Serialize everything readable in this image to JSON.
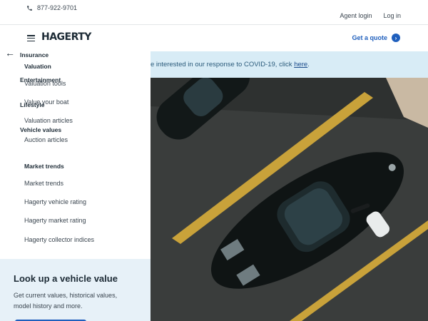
{
  "topbar": {
    "phone": "877-922-9701",
    "agent_login": "Agent login",
    "log_in": "Log in"
  },
  "header": {
    "logo": "HAGERTY",
    "get_quote": "Get a quote"
  },
  "banner": {
    "text": "e interested in our response to COVID-19, click ",
    "link": "here",
    "end": "."
  },
  "menu": {
    "categories": {
      "insurance": "Insurance",
      "entertainment": "Entertainment",
      "lifestyle": "Lifestyle",
      "vehicle_values": "Vehicle values"
    },
    "valuation_title": "Valuation",
    "valuation_items": [
      "Valuation tools",
      "Value your boat",
      "Valuation articles",
      "Auction articles"
    ],
    "trends_title": "Market trends",
    "trends_items": [
      "Market trends",
      "Hagerty vehicle rating",
      "Hagerty market rating",
      "Hagerty collector indices"
    ]
  },
  "lookup": {
    "title": "Look up a vehicle value",
    "description": "Get current values, historical values, model history and more."
  },
  "colors": {
    "accent": "#1f5fbd",
    "banner_bg": "#d8ecf6",
    "panel_promo_bg": "#e7f1f8"
  }
}
